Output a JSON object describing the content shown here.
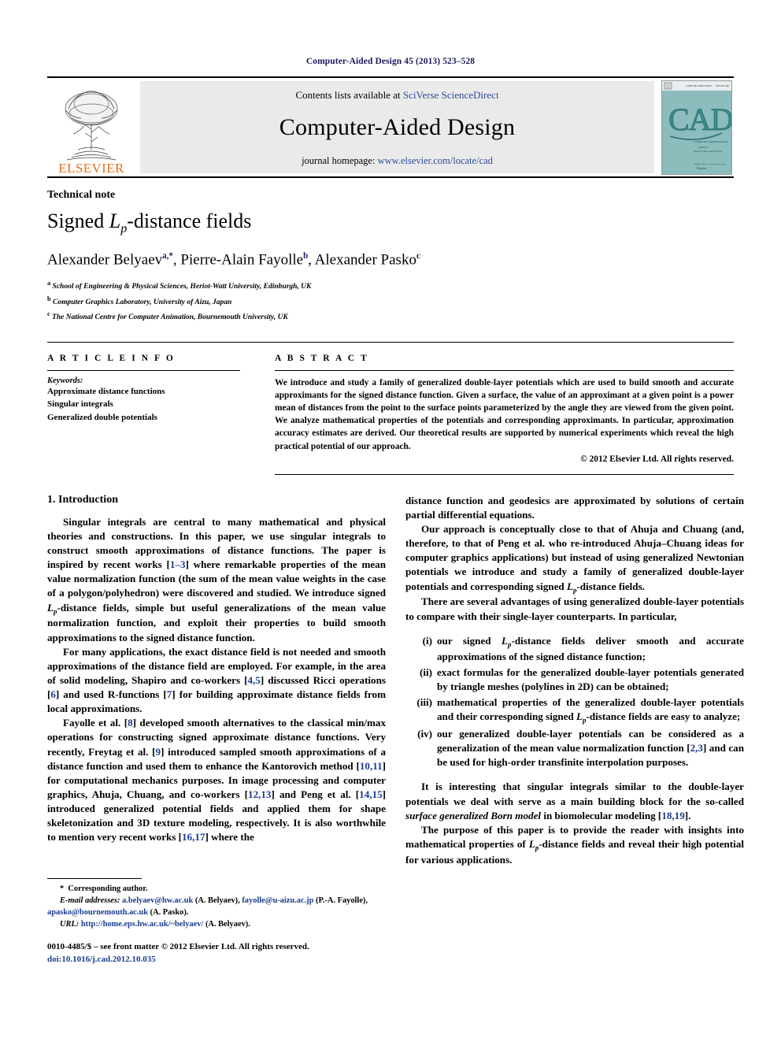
{
  "running_head": "Computer-Aided Design 45 (2013) 523–528",
  "masthead": {
    "publisher": "ELSEVIER",
    "contents_prefix": "Contents lists available at ",
    "contents_link": "SciVerse ScienceDirect",
    "journal_name": "Computer-Aided Design",
    "homepage_prefix": "journal homepage: ",
    "homepage_url": "www.elsevier.com/locate/cad",
    "cover_title": "CAD",
    "cover_subtitle": "COMPUTER-AIDED DESIGN"
  },
  "article": {
    "doctype": "Technical note",
    "title_part1": "Signed ",
    "title_math": "L",
    "title_sub": "p",
    "title_part2": "-distance fields",
    "authors": [
      {
        "name": "Alexander Belyaev",
        "marks": "a,*"
      },
      {
        "name": "Pierre-Alain Fayolle",
        "marks": "b"
      },
      {
        "name": "Alexander Pasko",
        "marks": "c"
      }
    ],
    "affiliations": [
      {
        "mark": "a",
        "text": "School of Engineering & Physical Sciences, Heriot-Watt University, Edinburgh, UK"
      },
      {
        "mark": "b",
        "text": "Computer Graphics Laboratory, University of Aizu, Japan"
      },
      {
        "mark": "c",
        "text": "The National Centre for Computer Animation, Bournemouth University, UK"
      }
    ]
  },
  "article_info": {
    "heading": "A R T I C L E   I N F O",
    "keywords_label": "Keywords:",
    "keywords": [
      "Approximate distance functions",
      "Singular integrals",
      "Generalized double potentials"
    ]
  },
  "abstract": {
    "heading": "A B S T R A C T",
    "text": "We introduce and study a family of generalized double-layer potentials which are used to build smooth and accurate approximants for the signed distance function. Given a surface, the value of an approximant at a given point is a power mean of distances from the point to the surface points parameterized by the angle they are viewed from the given point. We analyze mathematical properties of the potentials and corresponding approximants. In particular, approximation accuracy estimates are derived. Our theoretical results are supported by numerical experiments which reveal the high practical potential of our approach.",
    "copyright": "© 2012 Elsevier Ltd. All rights reserved."
  },
  "section1": {
    "title": "1. Introduction",
    "p1_a": "Singular integrals are central to many mathematical and physical theories and constructions. In this paper, we use singular integrals to construct smooth approximations of distance functions. The paper is inspired by recent works [",
    "p1_ref1": "1–3",
    "p1_b": "] where remarkable properties of the mean value normalization function (the sum of the mean value weights in the case of a polygon/polyhedron) were discovered and studied. We introduce signed ",
    "p1_c": "-distance fields, simple but useful generalizations of the mean value normalization function, and exploit their properties to build smooth approximations to the signed distance function.",
    "p2_a": "For many applications, the exact distance field is not needed and smooth approximations of the distance field are employed. For example, in the area of solid modeling, Shapiro and co-workers [",
    "p2_ref1": "4,5",
    "p2_b": "] discussed Ricci operations [",
    "p2_ref2": "6",
    "p2_c": "] and used R-functions [",
    "p2_ref3": "7",
    "p2_d": "] for building approximate distance fields from local approximations.",
    "p3_a": "Fayolle et al. [",
    "p3_ref1": "8",
    "p3_b": "] developed smooth alternatives to the classical min/max operations for constructing signed approximate distance functions. Very recently, Freytag et al. [",
    "p3_ref2": "9",
    "p3_c": "] introduced sampled smooth approximations of a distance function and used them to enhance the Kantorovich method [",
    "p3_ref3": "10,11",
    "p3_d": "] for computational mechanics purposes. In image processing and computer graphics, Ahuja, Chuang, and co-workers [",
    "p3_ref4": "12,13",
    "p3_e": "] and Peng et al. [",
    "p3_ref5": "14,15",
    "p3_f": "] introduced generalized potential fields and applied them for shape skeletonization and 3D texture modeling, respectively. It is also worthwhile to mention very recent works [",
    "p3_ref6": "16,17",
    "p3_g": "] where the"
  },
  "column2": {
    "p4": "distance function and geodesics are approximated by solutions of certain partial differential equations.",
    "p5_a": "Our approach is conceptually close to that of Ahuja and Chuang (and, therefore, to that of Peng et al. who re-introduced Ahuja–Chuang ideas for computer graphics applications) but instead of using generalized Newtonian potentials we introduce and study a family of generalized double-layer potentials and corresponding signed ",
    "p5_b": "-distance fields.",
    "p6": "There are several advantages of using generalized double-layer potentials to compare with their single-layer counterparts. In particular,",
    "list": [
      {
        "marker": "(i)",
        "text_a": "our signed ",
        "text_b": "-distance fields deliver smooth and accurate approximations of the signed distance function;",
        "has_math": true
      },
      {
        "marker": "(ii)",
        "text_a": "exact formulas for the generalized double-layer potentials generated by triangle meshes (polylines in 2D) can be obtained;",
        "has_math": false
      },
      {
        "marker": "(iii)",
        "text_a": "mathematical properties of the generalized double-layer potentials and their corresponding signed ",
        "text_b": "-distance fields are easy to analyze;",
        "has_math": true
      },
      {
        "marker": "(iv)",
        "text_a": "our generalized double-layer potentials can be considered as a generalization of the mean value normalization function [",
        "ref": "2,3",
        "text_b": "] and can be used for high-order transfinite interpolation purposes.",
        "has_math": false
      }
    ],
    "p7_a": "It is interesting that singular integrals similar to the double-layer potentials we deal with serve as a main building block for the so-called ",
    "p7_italic": "surface generalized Born model",
    "p7_b": " in biomolecular modeling [",
    "p7_ref": "18,19",
    "p7_c": "].",
    "p8_a": "The purpose of this paper is to provide the reader with insights into mathematical properties of ",
    "p8_b": "-distance fields and reveal their high potential for various applications."
  },
  "footnotes": {
    "corresponding_mark": "*",
    "corresponding_text": "Corresponding author.",
    "email_label": "E-mail addresses:",
    "email1": "a.belyaev@hw.ac.uk",
    "email1_owner": " (A. Belyaev), ",
    "email2": "fayolle@u-aizu.ac.jp",
    "email2_owner": " (P.-A. Fayolle), ",
    "email3": "apasko@bournemouth.ac.uk",
    "email3_owner": " (A. Pasko).",
    "url_label": "URL:",
    "url_value": "http://home.eps.hw.ac.uk/~belyaev/",
    "url_owner": " (A. Belyaev)."
  },
  "footer": {
    "issn_line": "0010-4485/$ – see front matter © 2012 Elsevier Ltd. All rights reserved.",
    "doi_line": "doi:10.1016/j.cad.2012.10.035"
  },
  "colors": {
    "link": "#2b4c9b",
    "reference": "#1a3d8f",
    "elsevier_orange": "#e8701a",
    "running_head": "#1a1a60",
    "cover_teal": "#7fb6b6"
  }
}
